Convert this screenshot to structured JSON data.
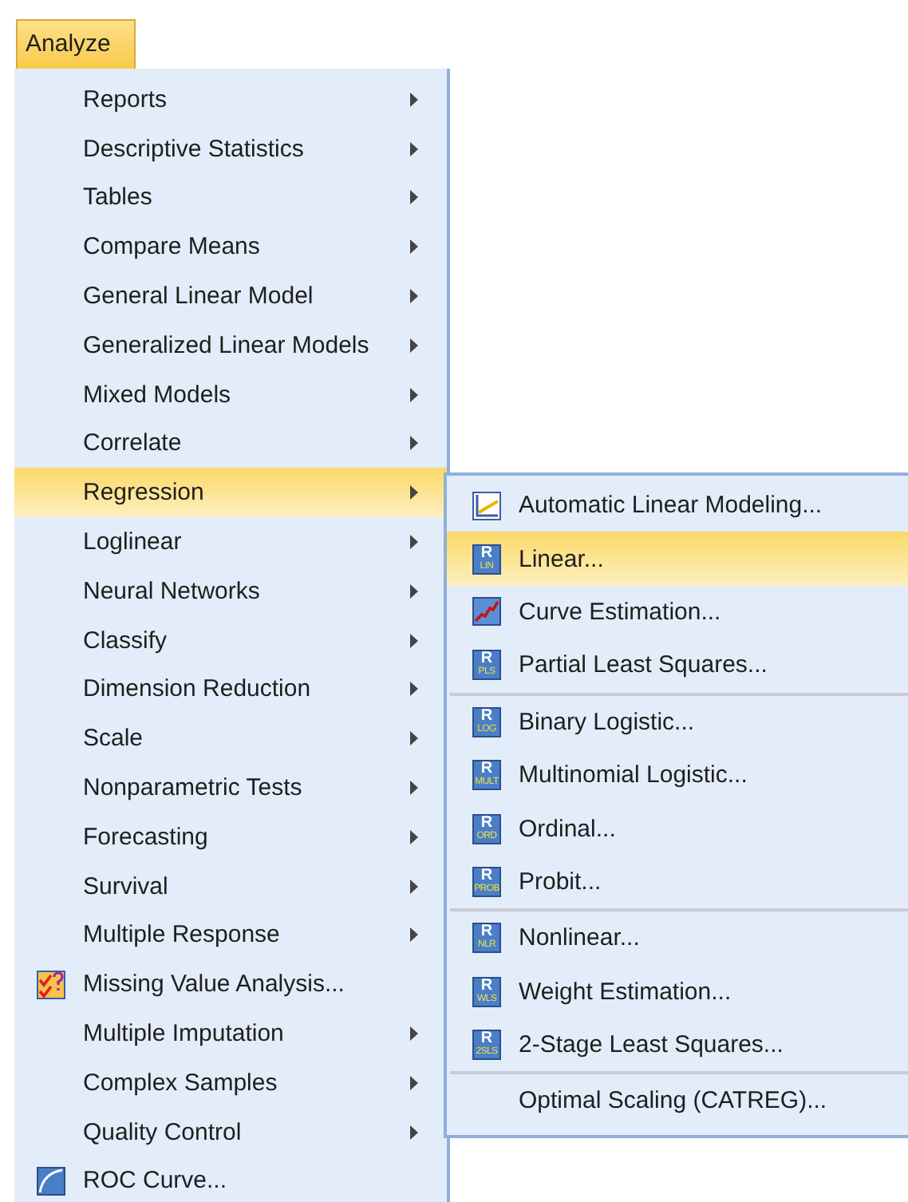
{
  "menubar": [
    {
      "label": "Analyze",
      "selected": true
    }
  ],
  "menu": {
    "items": [
      {
        "label": "Reports",
        "has_submenu": true,
        "selected": false
      },
      {
        "label": "Descriptive Statistics",
        "has_submenu": true,
        "selected": false
      },
      {
        "label": "Tables",
        "has_submenu": true,
        "selected": false
      },
      {
        "label": "Compare Means",
        "has_submenu": true,
        "selected": false
      },
      {
        "label": "General Linear Model",
        "has_submenu": true,
        "selected": false
      },
      {
        "label": "Generalized Linear Models",
        "has_submenu": true,
        "selected": false
      },
      {
        "label": "Mixed Models",
        "has_submenu": true,
        "selected": false
      },
      {
        "label": "Correlate",
        "has_submenu": true,
        "selected": false
      },
      {
        "label": "Regression",
        "has_submenu": true,
        "selected": true
      },
      {
        "label": "Loglinear",
        "has_submenu": true,
        "selected": false
      },
      {
        "label": "Neural Networks",
        "has_submenu": true,
        "selected": false
      },
      {
        "label": "Classify",
        "has_submenu": true,
        "selected": false
      },
      {
        "label": "Dimension Reduction",
        "has_submenu": true,
        "selected": false
      },
      {
        "label": "Scale",
        "has_submenu": true,
        "selected": false
      },
      {
        "label": "Nonparametric Tests",
        "has_submenu": true,
        "selected": false
      },
      {
        "label": "Forecasting",
        "has_submenu": true,
        "selected": false
      },
      {
        "label": "Survival",
        "has_submenu": true,
        "selected": false
      },
      {
        "label": "Multiple Response",
        "has_submenu": true,
        "selected": false
      },
      {
        "label": "Missing Value Analysis...",
        "has_submenu": false,
        "selected": false,
        "icon": {
          "kind": "missing-values"
        }
      },
      {
        "label": "Multiple Imputation",
        "has_submenu": true,
        "selected": false
      },
      {
        "label": "Complex Samples",
        "has_submenu": true,
        "selected": false
      },
      {
        "label": "Quality Control",
        "has_submenu": true,
        "selected": false
      },
      {
        "label": "ROC Curve...",
        "has_submenu": false,
        "selected": false,
        "icon": {
          "kind": "roc"
        }
      }
    ]
  },
  "submenu": {
    "items": [
      {
        "kind": "item",
        "label": "Automatic Linear Modeling...",
        "selected": false,
        "icon": {
          "kind": "line-chart"
        }
      },
      {
        "kind": "item",
        "label": "Linear...",
        "selected": true,
        "icon": {
          "kind": "r-badge",
          "top": "R",
          "bottom": "LIN"
        }
      },
      {
        "kind": "item",
        "label": "Curve Estimation...",
        "selected": false,
        "icon": {
          "kind": "curve"
        }
      },
      {
        "kind": "item",
        "label": "Partial Least Squares...",
        "selected": false,
        "icon": {
          "kind": "r-badge",
          "top": "R",
          "bottom": "PLS"
        }
      },
      {
        "kind": "separator"
      },
      {
        "kind": "item",
        "label": "Binary Logistic...",
        "selected": false,
        "icon": {
          "kind": "r-badge",
          "top": "R",
          "bottom": "LOG"
        }
      },
      {
        "kind": "item",
        "label": "Multinomial Logistic...",
        "selected": false,
        "icon": {
          "kind": "r-badge",
          "top": "R",
          "bottom": "MULT"
        }
      },
      {
        "kind": "item",
        "label": "Ordinal...",
        "selected": false,
        "icon": {
          "kind": "r-badge",
          "top": "R",
          "bottom": "ORD"
        }
      },
      {
        "kind": "item",
        "label": "Probit...",
        "selected": false,
        "icon": {
          "kind": "r-badge",
          "top": "R",
          "bottom": "PROB"
        }
      },
      {
        "kind": "separator"
      },
      {
        "kind": "item",
        "label": "Nonlinear...",
        "selected": false,
        "icon": {
          "kind": "r-badge",
          "top": "R",
          "bottom": "NLR"
        }
      },
      {
        "kind": "item",
        "label": "Weight Estimation...",
        "selected": false,
        "icon": {
          "kind": "r-badge",
          "top": "R",
          "bottom": "WLS"
        }
      },
      {
        "kind": "item",
        "label": "2-Stage Least Squares...",
        "selected": false,
        "icon": {
          "kind": "r-badge",
          "top": "R",
          "bottom": "2SLS"
        }
      },
      {
        "kind": "separator"
      },
      {
        "kind": "item",
        "label": "Optimal Scaling (CATREG)...",
        "selected": false
      }
    ]
  }
}
